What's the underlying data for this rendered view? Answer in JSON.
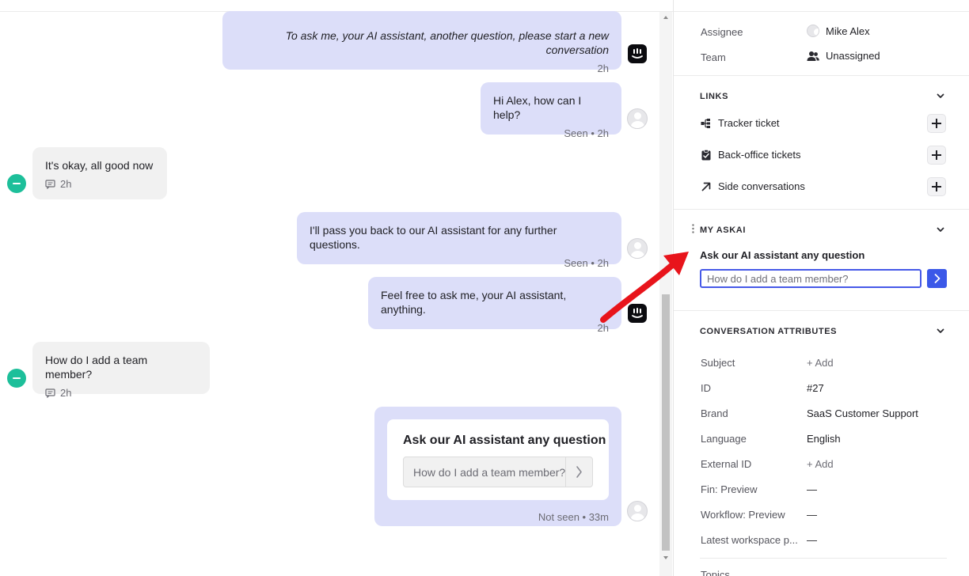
{
  "conversation": {
    "messages": [
      {
        "id": "m1",
        "direction": "out",
        "text": "To ask me, your AI assistant, another question, please start a new conversation",
        "meta": "2h",
        "avatar": "bot-logo-icon"
      },
      {
        "id": "m2",
        "direction": "out",
        "text": "Hi Alex, how can I help?",
        "meta": "Seen • 2h",
        "avatar": "user-avatar-icon"
      },
      {
        "id": "m3",
        "direction": "in",
        "text": "It's okay, all good now",
        "meta": "2h",
        "avatar": "customer-avatar-icon"
      },
      {
        "id": "m4",
        "direction": "out",
        "text": "I'll pass you back to our AI assistant for any further questions.",
        "meta": "Seen • 2h",
        "avatar": "user-avatar-icon"
      },
      {
        "id": "m5",
        "direction": "out",
        "text": "Feel free to ask me, your AI assistant, anything.",
        "meta": "2h",
        "avatar": "bot-logo-icon"
      },
      {
        "id": "m6",
        "direction": "in",
        "text": "How do I add a team member?",
        "meta": "2h",
        "avatar": "customer-avatar-icon"
      }
    ],
    "card": {
      "title": "Ask our AI assistant any question",
      "placeholder": "How do I add a team member?",
      "meta": "Not seen • 33m"
    }
  },
  "panel": {
    "top_rows": [
      {
        "label": "Assignee",
        "value": "Mike Alex",
        "icon": "user-avatar-icon"
      },
      {
        "label": "Team",
        "value": "Unassigned",
        "icon": "team-icon"
      }
    ],
    "links": {
      "title": "LINKS",
      "items": [
        {
          "label": "Tracker ticket",
          "icon": "tracker-icon"
        },
        {
          "label": "Back-office tickets",
          "icon": "clipboard-icon"
        },
        {
          "label": "Side conversations",
          "icon": "arrow-up-right-icon"
        }
      ]
    },
    "askai": {
      "title": "MY ASKAI",
      "prompt": "Ask our AI assistant any question",
      "placeholder": "How do I add a team member?"
    },
    "attributes": {
      "title": "CONVERSATION ATTRIBUTES",
      "rows": [
        {
          "label": "Subject",
          "value": "+ Add"
        },
        {
          "label": "ID",
          "value": "#27"
        },
        {
          "label": "Brand",
          "value": "SaaS Customer Support"
        },
        {
          "label": "Language",
          "value": "English"
        },
        {
          "label": "External ID",
          "value": "+ Add"
        },
        {
          "label": "Fin: Preview",
          "value": "—"
        },
        {
          "label": "Workflow: Preview",
          "value": "—"
        },
        {
          "label": "Latest workspace p...",
          "value": "—"
        }
      ],
      "next_section": "Topics"
    }
  },
  "colors": {
    "outgoing_bubble": "#dcdef9",
    "incoming_bubble": "#f1f1f1",
    "accent": "#3b58e8",
    "customer_avatar": "#1dbf9a",
    "annotation_arrow": "#e8141b"
  }
}
